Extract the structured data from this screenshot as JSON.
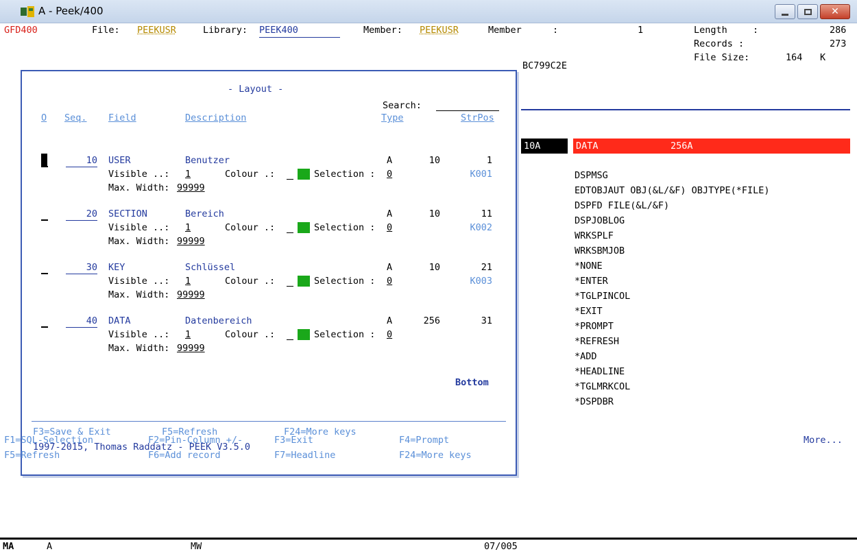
{
  "window": {
    "title": "A - Peek/400"
  },
  "header": {
    "program": "GFD400",
    "file_label": "File:",
    "file_value": "PEEKUSR",
    "library_label": "Library:",
    "library_value": "PEEK400",
    "member_label": "Member:",
    "member_value": "PEEKUSR",
    "member_label2": "Member",
    "member_colon": ":",
    "member_num": "1",
    "length_label": "Length",
    "length_colon": ":",
    "length_value": "286",
    "records_label": "Records :",
    "records_value": "273",
    "file_size_label": "File Size:",
    "file_size_value": "164",
    "file_size_unit": "K",
    "hash": "BC799C2E"
  },
  "popup": {
    "title": "- Layout -",
    "search_label": "Search:",
    "columns": {
      "opt": "O",
      "seq": "Seq.",
      "field": "Field",
      "description": "Description",
      "type": "Type",
      "strpos": "StrPos"
    },
    "rows": [
      {
        "seq": "10",
        "field": "USER",
        "description": "Benutzer",
        "type": "A",
        "len": "10",
        "strpos": "1",
        "visible": "1",
        "selection": "0",
        "key": "K001",
        "max_width": "99999"
      },
      {
        "seq": "20",
        "field": "SECTION",
        "description": "Bereich",
        "type": "A",
        "len": "10",
        "strpos": "11",
        "visible": "1",
        "selection": "0",
        "key": "K002",
        "max_width": "99999"
      },
      {
        "seq": "30",
        "field": "KEY",
        "description": "Schlüssel",
        "type": "A",
        "len": "10",
        "strpos": "21",
        "visible": "1",
        "selection": "0",
        "key": "K003",
        "max_width": "99999"
      },
      {
        "seq": "40",
        "field": "DATA",
        "description": "Datenbereich",
        "type": "A",
        "len": "256",
        "strpos": "31",
        "visible": "1",
        "selection": "0",
        "key": "",
        "max_width": "99999"
      }
    ],
    "visible_label": "Visible ..:",
    "colour_label": "Colour .:",
    "selection_label": "Selection :",
    "max_width_label": "Max. Width:",
    "bottom": "Bottom",
    "fkeys": {
      "f3": "F3=Save & Exit",
      "f5": "F5=Refresh",
      "f24": "F24=More keys"
    },
    "copyright": "1997-2015, Thomas Raddatz - PEEK V3.5.0"
  },
  "right": {
    "col1": "10A",
    "col2": "DATA",
    "col2_len": "256A",
    "commands": [
      "DSPMSG",
      "EDTOBJAUT OBJ(&L/&F) OBJTYPE(*FILE)",
      "DSPFD FILE(&L/&F)",
      "DSPJOBLOG",
      "WRKSPLF",
      "WRKSBMJOB",
      "*NONE",
      "*ENTER",
      "*TGLPINCOL",
      "*EXIT",
      "*PROMPT",
      "*REFRESH",
      "*ADD",
      "*HEADLINE",
      "*TGLMRKCOL",
      "*DSPDBR"
    ],
    "more": "More..."
  },
  "fkeys": {
    "f1": "F1=SQL-Selection",
    "f2": "F2=Pin-Column +/-",
    "f3": "F3=Exit",
    "f4": "F4=Prompt",
    "f5": "F5=Refresh",
    "f6": "F6=Add record",
    "f7": "F7=Headline",
    "f24": "F24=More keys"
  },
  "status": {
    "indicator": "MA",
    "session": "A",
    "mode": "MW",
    "cursor_pos": "07/005"
  },
  "colors": {
    "accent_blue": "#233a9e",
    "red_bar": "#ff2a1a",
    "green_swatch": "#1aa81a"
  }
}
